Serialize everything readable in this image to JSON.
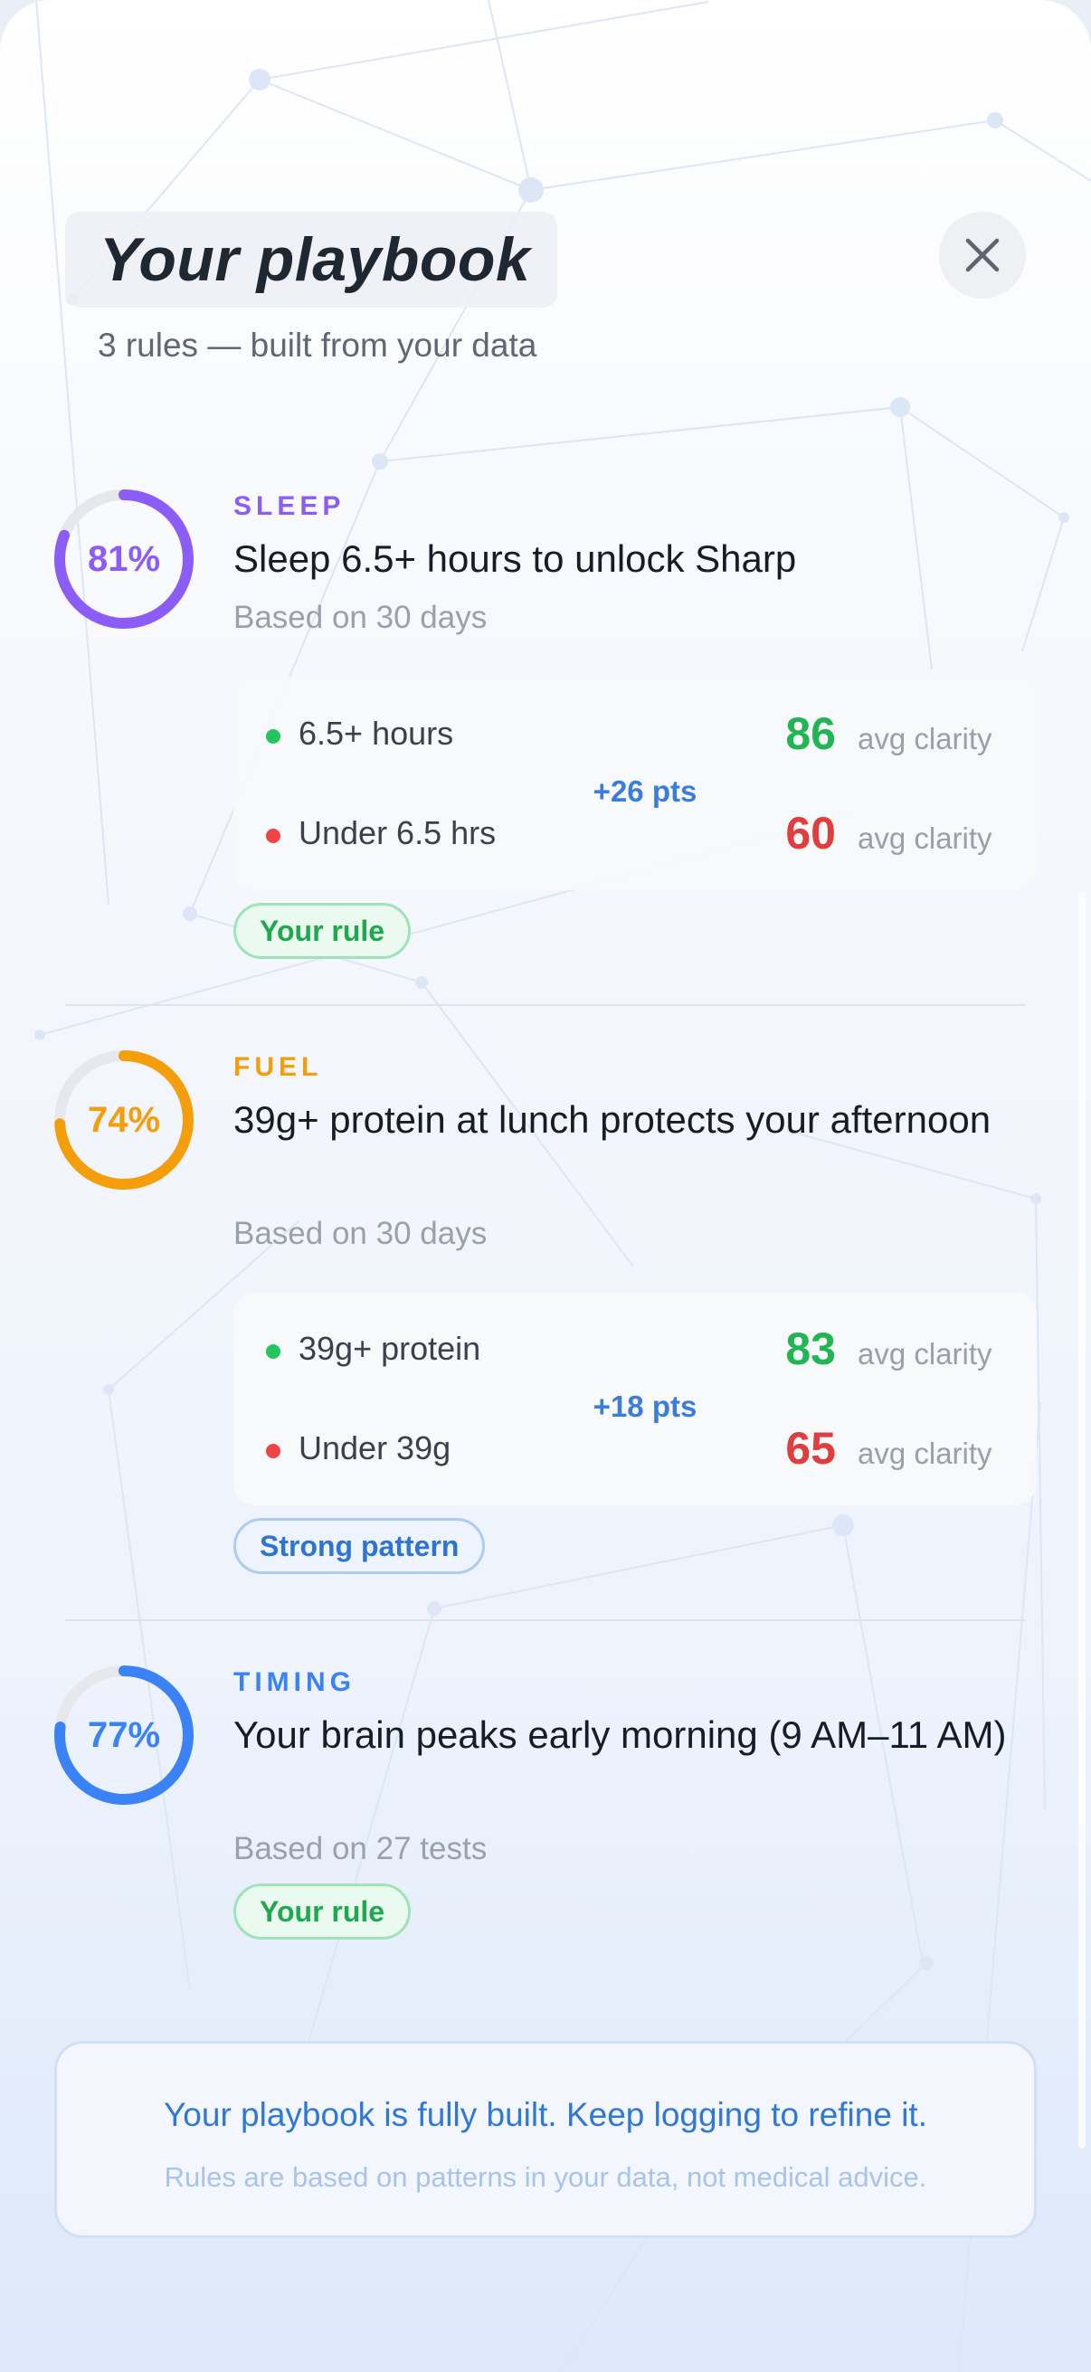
{
  "header": {
    "title": "Your playbook",
    "subtitle": "3 rules — built from your data",
    "close_icon": "close-icon"
  },
  "rules": [
    {
      "percent_label": "81%",
      "confidence": 0.81,
      "color": "#8b5cf6",
      "category": "SLEEP",
      "title": "Sleep 6.5+ hours to unlock Sharp",
      "based_on": "Based on 30 days",
      "comparison": {
        "high_label": "6.5+ hours",
        "high_value": "86",
        "low_label": "Under 6.5 hrs",
        "low_value": "60",
        "unit": "avg clarity",
        "delta": "+26 pts"
      },
      "badge": "Your rule"
    },
    {
      "percent_label": "74%",
      "confidence": 0.74,
      "color": "#f59e0b",
      "category": "FUEL",
      "title": "39g+ protein at lunch protects your afternoon",
      "based_on": "Based on 30 days",
      "comparison": {
        "high_label": "39g+ protein",
        "high_value": "83",
        "low_label": "Under 39g",
        "low_value": "65",
        "unit": "avg clarity",
        "delta": "+18 pts"
      },
      "badge": "Strong pattern"
    },
    {
      "percent_label": "77%",
      "confidence": 0.77,
      "color": "#3b82f6",
      "category": "TIMING",
      "title": "Your brain peaks early morning (9 AM–11 AM)",
      "based_on": "Based on 27 tests",
      "badge": "Your rule"
    }
  ],
  "footer": {
    "main": "Your playbook is fully built. Keep logging to refine it.",
    "sub": "Rules are based on patterns in your data, not medical advice."
  },
  "colors": {
    "positive": "#22c55e",
    "negative": "#ef4444",
    "accent": "#3b7ddd"
  }
}
